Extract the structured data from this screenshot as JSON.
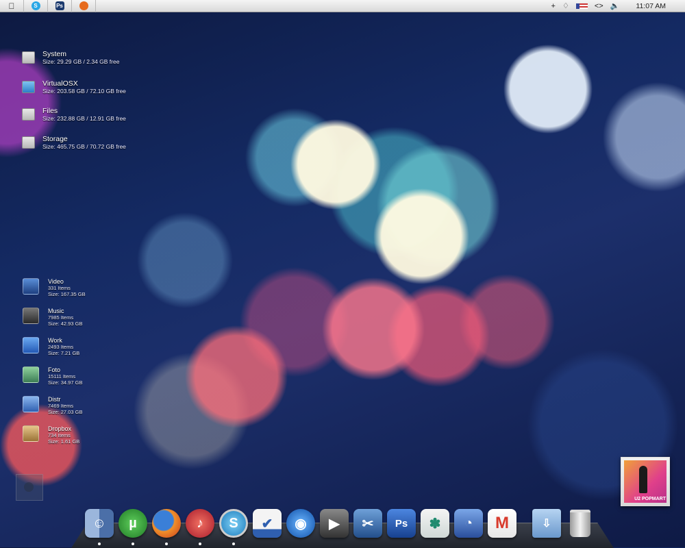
{
  "menubar": {
    "apple_icon": "apple-logo",
    "apps": [
      {
        "icon": "skype-icon",
        "glyph": "S",
        "color": "#2aa7e6"
      },
      {
        "icon": "photoshop-icon",
        "glyph": "Ps",
        "color": "#1c3a6e"
      },
      {
        "icon": "firefox-icon",
        "glyph": "",
        "color": "#e66a1c"
      }
    ],
    "status_glyphs": {
      "plus": "+",
      "drop": "♢",
      "code": "<>",
      "volume": "🔈"
    },
    "clock": "11:07 AM"
  },
  "drives": [
    {
      "name": "System",
      "size": "Size: 29.29 GB /   2.34 GB free",
      "icon": "hard-drive-icon"
    },
    {
      "name": "VirtualOSX",
      "size": "Size: 203.58 GB / 72.10 GB free",
      "icon": "virtual-drive-icon"
    },
    {
      "name": "Files",
      "size": "Size: 232.88 GB / 12.91 GB free",
      "icon": "hard-drive-icon"
    },
    {
      "name": "Storage",
      "size": "Size: 465.75 GB / 70.72 GB free",
      "icon": "hard-drive-icon"
    }
  ],
  "folders": [
    {
      "name": "Video",
      "items": "331 Items",
      "size": "Size: 167.35 GB",
      "icon": "video-folder-icon",
      "color": "#2b5aa8"
    },
    {
      "name": "Music",
      "items": "7985 Items",
      "size": "Size: 42.93 GB",
      "icon": "music-folder-icon",
      "color": "#3a3a3a"
    },
    {
      "name": "Work",
      "items": "2493 Items",
      "size": "Size: 7.21 GB",
      "icon": "work-folder-icon",
      "color": "#3576d1"
    },
    {
      "name": "Foto",
      "items": "15111 Items",
      "size": "Size: 34.97 GB",
      "icon": "photo-folder-icon",
      "color": "#3f8a54"
    },
    {
      "name": "Distr",
      "items": "7469 Items",
      "size": "Size: 27.03 GB",
      "icon": "distr-folder-icon",
      "color": "#4a7ec9"
    },
    {
      "name": "Dropbox",
      "items": "734 Items",
      "size": "Size: 1.61 GB",
      "icon": "dropbox-folder-icon",
      "color": "#b08a4a"
    }
  ],
  "album": {
    "label": "U2 POPMART"
  },
  "dock": [
    {
      "name": "finder",
      "glyph": "☺",
      "color": "#6d8bb8"
    },
    {
      "name": "utorrent",
      "glyph": "µ",
      "color": "#2e8f36",
      "round": true
    },
    {
      "name": "firefox",
      "glyph": "",
      "color": "#e2652a",
      "round": true
    },
    {
      "name": "itunes",
      "glyph": "♪",
      "color": "#d93c44",
      "round": true
    },
    {
      "name": "skype",
      "glyph": "S",
      "color": "#3aa0d8",
      "round": true
    },
    {
      "name": "ical-tasks",
      "glyph": "✔",
      "color": "#2f5fb0"
    },
    {
      "name": "app-drop",
      "glyph": "◉",
      "color": "#1e6fd0",
      "round": true
    },
    {
      "name": "photo-booth",
      "glyph": "▶",
      "color": "#5c5c5c"
    },
    {
      "name": "video-editor",
      "glyph": "✂",
      "color": "#3a6fa8"
    },
    {
      "name": "photoshop",
      "glyph": "Ps",
      "color": "#2a5fb8"
    },
    {
      "name": "growl",
      "glyph": "✽",
      "color": "#2f9a7e"
    },
    {
      "name": "preview",
      "glyph": "◔",
      "color": "#3a62b8"
    },
    {
      "name": "gmail",
      "glyph": "M",
      "color": "#d83a2c"
    }
  ]
}
